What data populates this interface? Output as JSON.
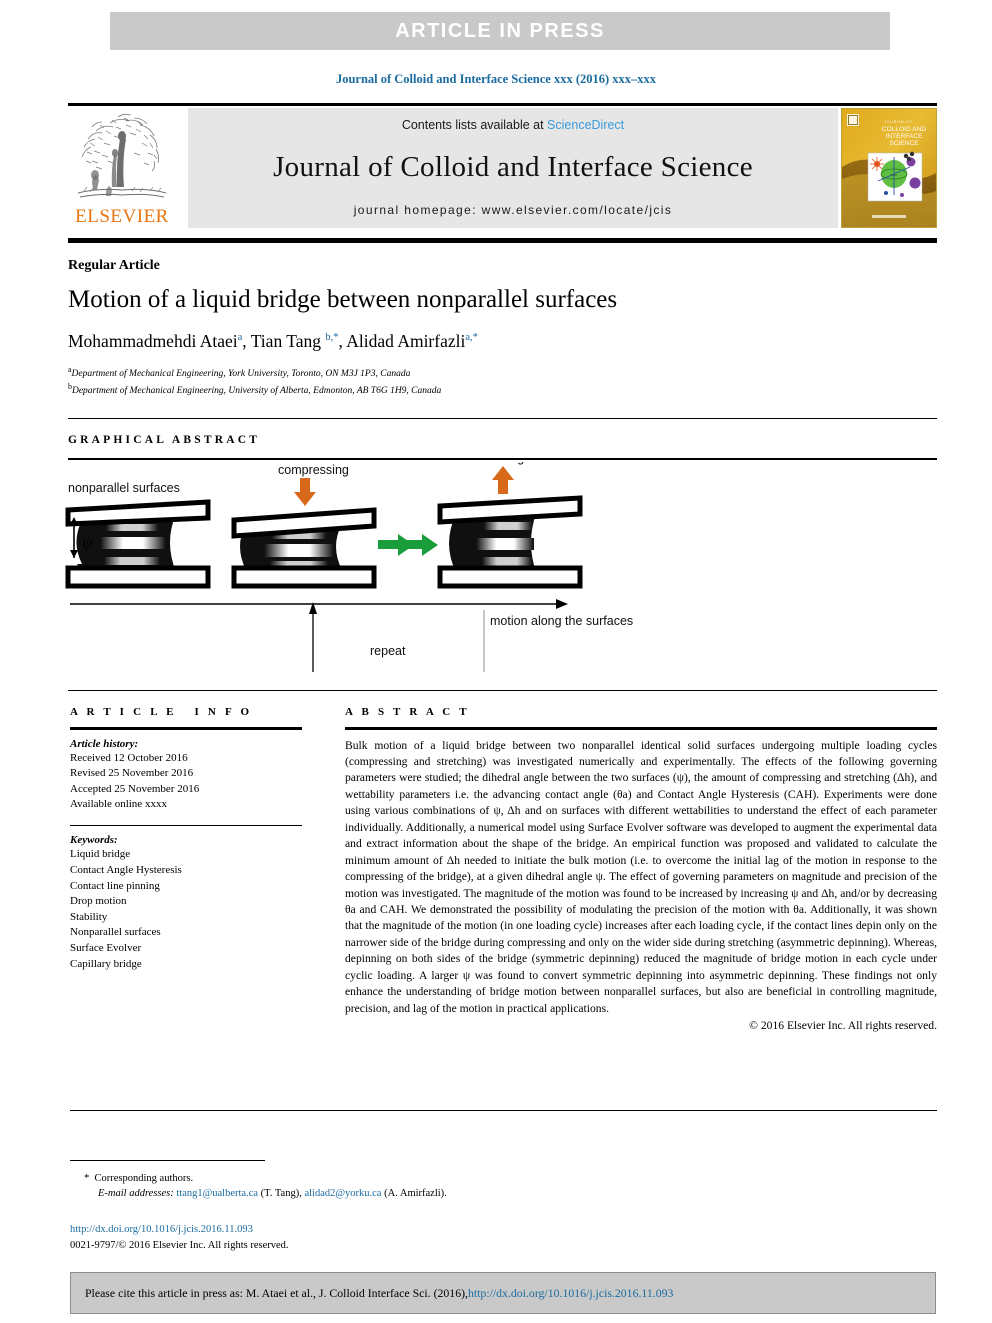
{
  "banner": {
    "text": "ARTICLE  IN  PRESS"
  },
  "running_head": {
    "text": "Journal of Colloid and Interface Science xxx (2016) xxx–xxx"
  },
  "masthead": {
    "publisher": "ELSEVIER",
    "contents_prefix": "Contents lists available at ",
    "contents_link": "ScienceDirect",
    "journal_title": "Journal of Colloid and Interface Science",
    "homepage": "journal homepage: www.elsevier.com/locate/jcis"
  },
  "article": {
    "type": "Regular Article",
    "title": "Motion of a liquid bridge between nonparallel surfaces",
    "authors": [
      {
        "name": "Mohammadmehdi Ataei",
        "marks": "a"
      },
      {
        "name": "Tian Tang",
        "marks": "b,*"
      },
      {
        "name": "Alidad Amirfazli",
        "marks": "a,*"
      }
    ],
    "affiliations": [
      {
        "mark": "a",
        "text": "Department of Mechanical Engineering, York University, Toronto, ON M3J 1P3, Canada"
      },
      {
        "mark": "b",
        "text": "Department of Mechanical Engineering, University of Alberta, Edmonton, AB T6G 1H9, Canada"
      }
    ]
  },
  "graphical_abstract": {
    "heading": "GRAPHICAL ABSTRACT",
    "labels": {
      "nonparallel": "nonparallel surfaces",
      "compressing": "compressing",
      "stretching": "stretching",
      "motion": "motion along the surfaces",
      "repeat": "repeat",
      "psi": "ψ"
    },
    "colors": {
      "compress_arrow": "#d9691a",
      "motion_arrow": "#1a9e3c"
    }
  },
  "article_info": {
    "heading": "ARTICLE INFO",
    "history_label": "Article history:",
    "history": [
      "Received 12 October 2016",
      "Revised 25 November 2016",
      "Accepted 25 November 2016",
      "Available online xxxx"
    ],
    "keywords_label": "Keywords:",
    "keywords": [
      "Liquid bridge",
      "Contact Angle Hysteresis",
      "Contact line pinning",
      "Drop motion",
      "Stability",
      "Nonparallel surfaces",
      "Surface Evolver",
      "Capillary bridge"
    ]
  },
  "abstract": {
    "heading": "ABSTRACT",
    "body": "Bulk motion of a liquid bridge between two nonparallel identical solid surfaces undergoing multiple loading cycles (compressing and stretching) was investigated numerically and experimentally. The effects of the following governing parameters were studied; the dihedral angle between the two surfaces (ψ), the amount of compressing and stretching (Δh), and wettability parameters i.e. the advancing contact angle (θa) and Contact Angle Hysteresis (CAH). Experiments were done using various combinations of ψ, Δh and on surfaces with different wettabilities to understand the effect of each parameter individually. Additionally, a numerical model using Surface Evolver software was developed to augment the experimental data and extract information about the shape of the bridge. An empirical function was proposed and validated to calculate the minimum amount of Δh needed to initiate the bulk motion (i.e. to overcome the initial lag of the motion in response to the compressing of the bridge), at a given dihedral angle ψ. The effect of governing parameters on magnitude and precision of the motion was investigated. The magnitude of the motion was found to be increased by increasing ψ and Δh, and/or by decreasing θa and CAH. We demonstrated the possibility of modulating the precision of the motion with θa. Additionally, it was shown that the magnitude of the motion (in one loading cycle) increases after each loading cycle, if the contact lines depin only on the narrower side of the bridge during compressing and only on the wider side during stretching (asymmetric depinning). Whereas, depinning on both sides of the bridge (symmetric depinning) reduced the magnitude of bridge motion in each cycle under cyclic loading. A larger ψ was found to convert symmetric depinning into asymmetric depinning. These findings not only enhance the understanding of bridge motion between nonparallel surfaces, but also are beneficial in controlling magnitude, precision, and lag of the motion in practical applications.",
    "copyright": "© 2016 Elsevier Inc. All rights reserved."
  },
  "footnotes": {
    "corresponding": "Corresponding authors.",
    "email_label": "E-mail addresses:",
    "email1": "ttang1@ualberta.ca",
    "email1_owner": "(T. Tang),",
    "email2": "alidad2@yorku.ca",
    "email2_owner": "(A. Amirfazli).",
    "doi": "http://dx.doi.org/10.1016/j.jcis.2016.11.093",
    "issn_line": "0021-9797/© 2016 Elsevier Inc. All rights reserved."
  },
  "citation_bar": {
    "text": "Please cite this article in press as: M. Ataei et al., J. Colloid Interface Sci. (2016), ",
    "link": "http://dx.doi.org/10.1016/j.jcis.2016.11.093"
  }
}
